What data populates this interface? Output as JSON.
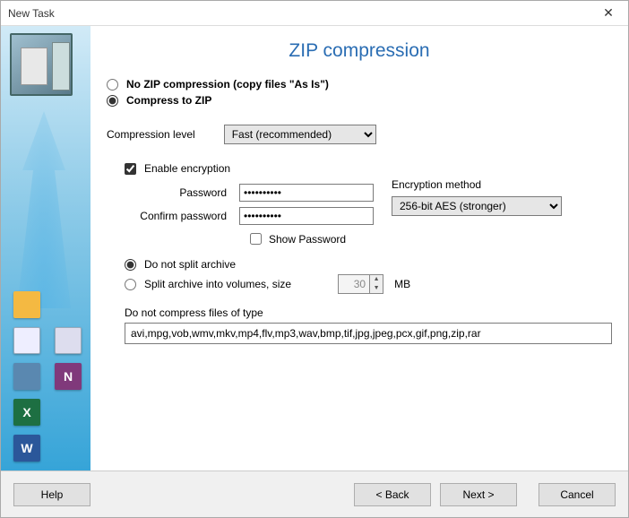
{
  "window": {
    "title": "New Task"
  },
  "page": {
    "title": "ZIP compression"
  },
  "options": {
    "no_zip_label": "No ZIP compression (copy files \"As Is\")",
    "compress_label": "Compress to ZIP",
    "selected": "compress"
  },
  "compression": {
    "level_label": "Compression level",
    "level_value": "Fast (recommended)"
  },
  "encryption": {
    "enable_label": "Enable encryption",
    "enabled": true,
    "password_label": "Password",
    "confirm_label": "Confirm password",
    "password_value": "••••••••••",
    "confirm_value": "••••••••••",
    "show_pw_label": "Show Password",
    "method_label": "Encryption method",
    "method_value": "256-bit  AES (stronger)"
  },
  "split": {
    "no_split_label": "Do not split archive",
    "split_label": "Split archive into volumes, size",
    "selected": "no_split",
    "size_value": "30",
    "unit": "MB"
  },
  "exclude": {
    "label": "Do not compress files of type",
    "value": "avi,mpg,vob,wmv,mkv,mp4,flv,mp3,wav,bmp,tif,jpg,jpeg,pcx,gif,png,zip,rar"
  },
  "buttons": {
    "help": "Help",
    "back": "< Back",
    "next": "Next >",
    "cancel": "Cancel"
  }
}
